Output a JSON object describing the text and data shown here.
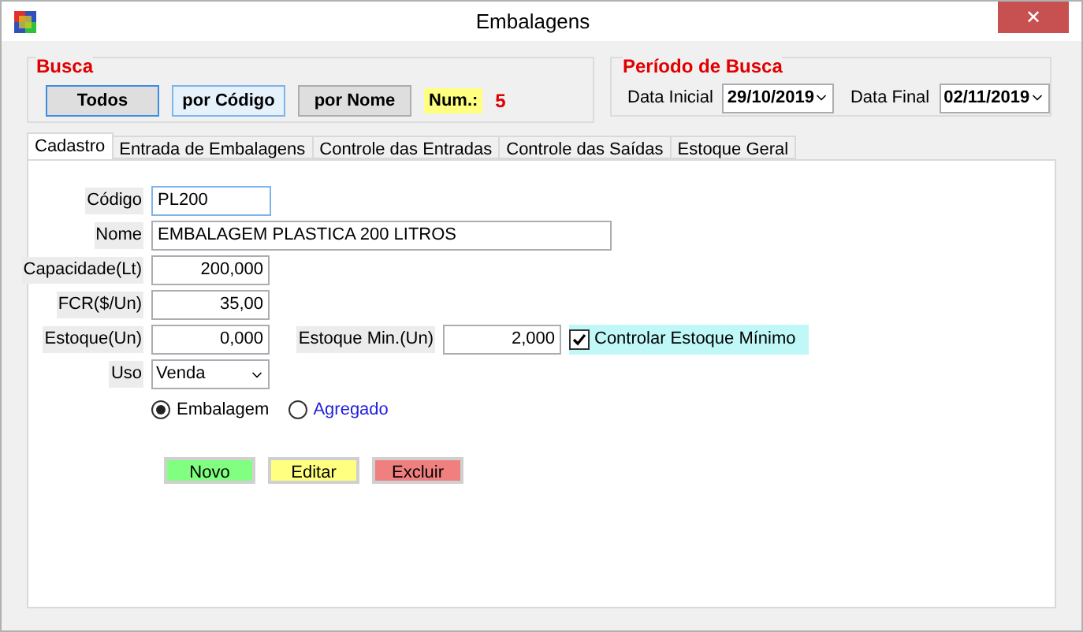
{
  "window": {
    "title": "Embalagens",
    "close": "✕"
  },
  "busca": {
    "title": "Busca",
    "buttons": [
      {
        "label": "Todos",
        "focused": true,
        "hovered": false
      },
      {
        "label": "por Código",
        "focused": false,
        "hovered": true
      },
      {
        "label": "por Nome",
        "focused": false,
        "hovered": false
      }
    ],
    "count_label": "Num.:",
    "count": "5"
  },
  "periodo": {
    "title": "Período de Busca",
    "start_label": "Data Inicial",
    "start": "29/10/2019",
    "end_label": "Data Final",
    "end": "02/11/2019"
  },
  "tabs": [
    {
      "label": "Cadastro",
      "selected": true
    },
    {
      "label": "Entrada de Embalagens",
      "selected": false
    },
    {
      "label": "Controle das Entradas",
      "selected": false
    },
    {
      "label": "Controle das Saídas",
      "selected": false
    },
    {
      "label": "Estoque Geral",
      "selected": false
    }
  ],
  "form": {
    "codigo": {
      "label": "Código",
      "value": "PL200",
      "focused": true
    },
    "nome": {
      "label": "Nome",
      "value": "EMBALAGEM PLASTICA 200 LITROS"
    },
    "capacidade": {
      "label": "Capacidade(Lt)",
      "value": "200,000"
    },
    "fcr": {
      "label": "FCR($/Un)",
      "value": "35,00"
    },
    "estoque": {
      "label": "Estoque(Un)",
      "value": "0,000"
    },
    "estoque_min": {
      "label": "Estoque Min.(Un)",
      "value": "2,000"
    },
    "controlar": {
      "label": "Controlar Estoque Mínimo",
      "checked": true
    },
    "uso": {
      "label": "Uso",
      "value": "Venda"
    },
    "tipo": [
      {
        "label": "Embalagem",
        "selected": true
      },
      {
        "label": "Agregado",
        "selected": false
      }
    ]
  },
  "actions": [
    {
      "label": "Novo",
      "color": "#80ff80"
    },
    {
      "label": "Editar",
      "color": "#ffff80"
    },
    {
      "label": "Excluir",
      "color": "#f08080"
    }
  ]
}
